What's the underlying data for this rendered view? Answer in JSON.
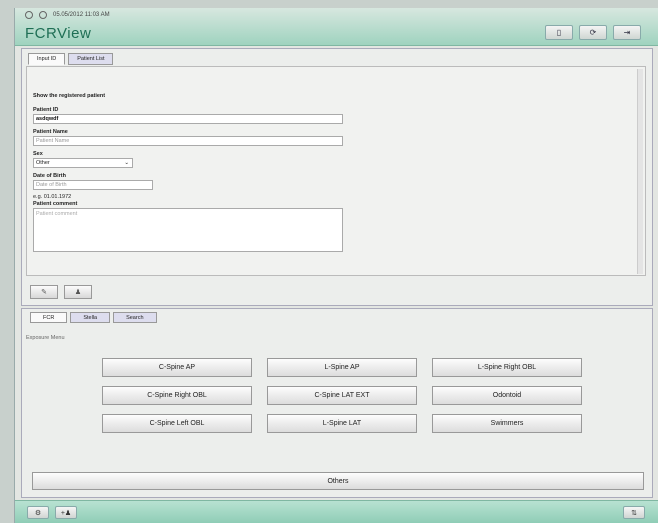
{
  "header": {
    "status_text": "05.05/2012 11:03 AM",
    "title": "FCRView",
    "buttons": [
      {
        "icon": "battery-icon",
        "glyph": "▯"
      },
      {
        "icon": "refresh-icon",
        "glyph": "⟳"
      },
      {
        "icon": "exit-icon",
        "glyph": "⇥"
      }
    ]
  },
  "upper": {
    "tabs": [
      "Input ID",
      "Patient List"
    ],
    "section_title": "Show the registered patient",
    "patient_id_label": "Patient ID",
    "patient_id_value": "asdqwdf",
    "patient_name_label": "Patient Name",
    "patient_name_placeholder": "Patient Name",
    "sex_label": "Sex",
    "sex_value": "Other",
    "dob_label": "Date of Birth",
    "dob_placeholder": "Date of Birth",
    "dob_hint": "e.g. 01.01.1972",
    "comment_label": "Patient comment",
    "comment_placeholder": "Patient comment"
  },
  "lower": {
    "tabs": [
      "FCR",
      "Stella",
      "Search"
    ],
    "exposure_menu": "Exposure Menu",
    "buttons": [
      [
        "C-Spine AP",
        "L-Spine AP",
        "L-Spine Right OBL"
      ],
      [
        "C-Spine Right OBL",
        "C-Spine LAT EXT",
        "Odontoid"
      ],
      [
        "C-Spine Left OBL",
        "L-Spine LAT",
        "Swimmers"
      ]
    ],
    "others": "Others"
  }
}
